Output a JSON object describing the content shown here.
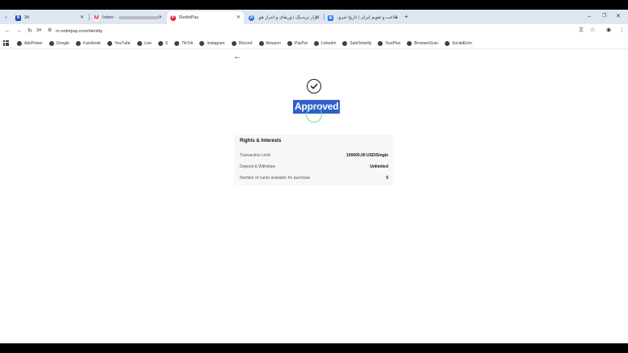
{
  "browser": {
    "tabs": [
      {
        "title": "34",
        "favicon": "blue-n-icon",
        "favicon_color": "#1f46c4"
      },
      {
        "title": "Inbox - ",
        "favicon": "gmail-icon",
        "favicon_color": "#d93025"
      },
      {
        "title": "RedotPay",
        "favicon": "redotpay-icon",
        "favicon_color": "#e0242c"
      },
      {
        "title": "ابزار تریدینگ | وریفای و اجراز هو...",
        "favicon": "a-logo-icon",
        "favicon_color": "#1a73e8"
      },
      {
        "title": "ساعت و تقویم ایران | تاریخ امرو...",
        "favicon": "calendar-icon",
        "favicon_color": "#1a73e8"
      }
    ],
    "tab_count_badge": "34",
    "url": "m.redotpay.com/identity",
    "bookmarks": [
      "AdsPower",
      "Google",
      "Facebook",
      "YouTube",
      "Live",
      "X",
      "TikTok",
      "Instagram",
      "Discord",
      "Amazon",
      "PayPal",
      "Linkedin",
      "SaleSmartly",
      "DuoPlus",
      "BrowserScan",
      "SocialEcho"
    ]
  },
  "page": {
    "status": "Approved",
    "card": {
      "title": "Rights & Interests",
      "rows": [
        {
          "label": "Transaction Limit",
          "value": "100000.00 USD/Single"
        },
        {
          "label": "Deposit & Withdraw",
          "value": "Unlimited"
        },
        {
          "label": "Number of cards available for purchase",
          "value": "5"
        }
      ]
    }
  },
  "colors": {
    "status_highlight": "#2f5fd0",
    "tabstrip_bg": "#dfe6f1",
    "card_bg": "#f7f7f8"
  }
}
